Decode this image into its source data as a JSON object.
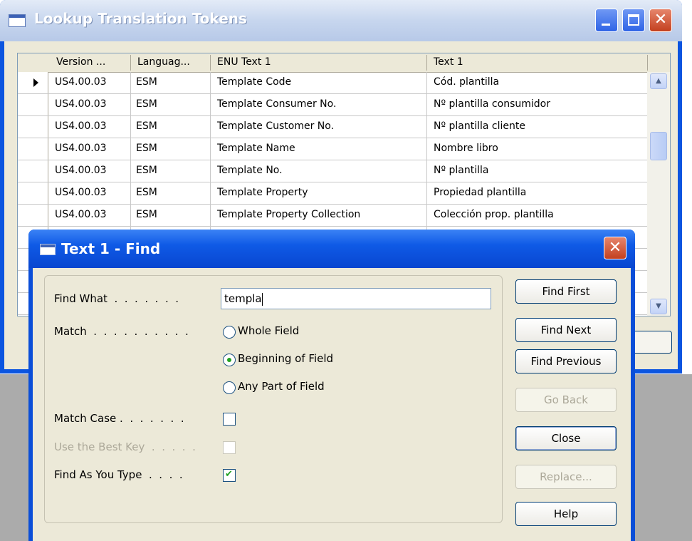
{
  "back_window": {
    "title": "Lookup Translation Tokens",
    "columns": [
      "Version ...",
      "Languag...",
      "ENU Text 1",
      "Text 1"
    ],
    "rows": [
      [
        "US4.00.03",
        "ESM",
        "Template Code",
        "Cód. plantilla"
      ],
      [
        "US4.00.03",
        "ESM",
        "Template Consumer No.",
        "Nº plantilla consumidor"
      ],
      [
        "US4.00.03",
        "ESM",
        "Template Customer No.",
        "Nº plantilla cliente"
      ],
      [
        "US4.00.03",
        "ESM",
        "Template Name",
        "Nombre libro"
      ],
      [
        "US4.00.03",
        "ESM",
        "Template No.",
        "Nº plantilla"
      ],
      [
        "US4.00.03",
        "ESM",
        "Template Property",
        "Propiedad plantilla"
      ],
      [
        "US4.00.03",
        "ESM",
        "Template Property Collection",
        "Colección prop. plantilla"
      ]
    ]
  },
  "dialog": {
    "title": "Text 1 - Find",
    "find_what_label": "Find What  .  .  .  .  .  .  .",
    "find_what_value": "templa",
    "match_label": "Match  .  .  .  .  .  .  .  .  .  .",
    "match_options": [
      "Whole Field",
      "Beginning of Field",
      "Any Part of Field"
    ],
    "match_selected": "Beginning of Field",
    "match_case_label": "Match Case .  .  .  .  .  .  .",
    "use_best_key_label": "Use the Best Key  .  .  .  .  .",
    "find_as_you_type_label": "Find As You Type  .  .  .  .",
    "match_case": false,
    "use_best_key": false,
    "find_as_you_type": true,
    "buttons": {
      "find_first": "Find First",
      "find_next": "Find Next",
      "find_previous": "Find Previous",
      "go_back": "Go Back",
      "close": "Close",
      "replace": "Replace...",
      "help": "Help"
    }
  },
  "colors": {
    "titlebar_active": "#0a4ed8",
    "titlebar_inactive": "#c7d6ee",
    "window_face": "#ece9d8",
    "check_green": "#21a121"
  }
}
